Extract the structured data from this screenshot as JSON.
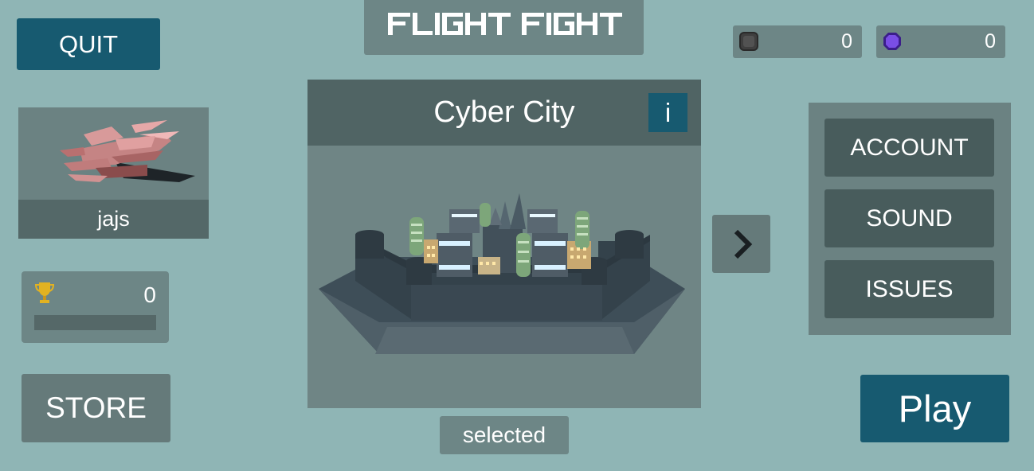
{
  "title": "FLIGHT FIGHT",
  "quit_label": "QUIT",
  "currencies": [
    {
      "icon": "gray-gem-icon",
      "value": "0",
      "color": "#4a4a4a"
    },
    {
      "icon": "purple-gem-icon",
      "value": "0",
      "color": "#6a3fd0"
    }
  ],
  "player": {
    "name": "jajs",
    "trophies": "0",
    "trophy_progress": 0
  },
  "store_label": "STORE",
  "map": {
    "name": "Cyber City",
    "info_label": "i",
    "status": "selected"
  },
  "settings": {
    "account": "ACCOUNT",
    "sound": "SOUND",
    "issues": "ISSUES"
  },
  "play_label": "Play",
  "colors": {
    "background": "#8fb5b5",
    "accent": "#175a70",
    "panel": "#6d8686"
  }
}
